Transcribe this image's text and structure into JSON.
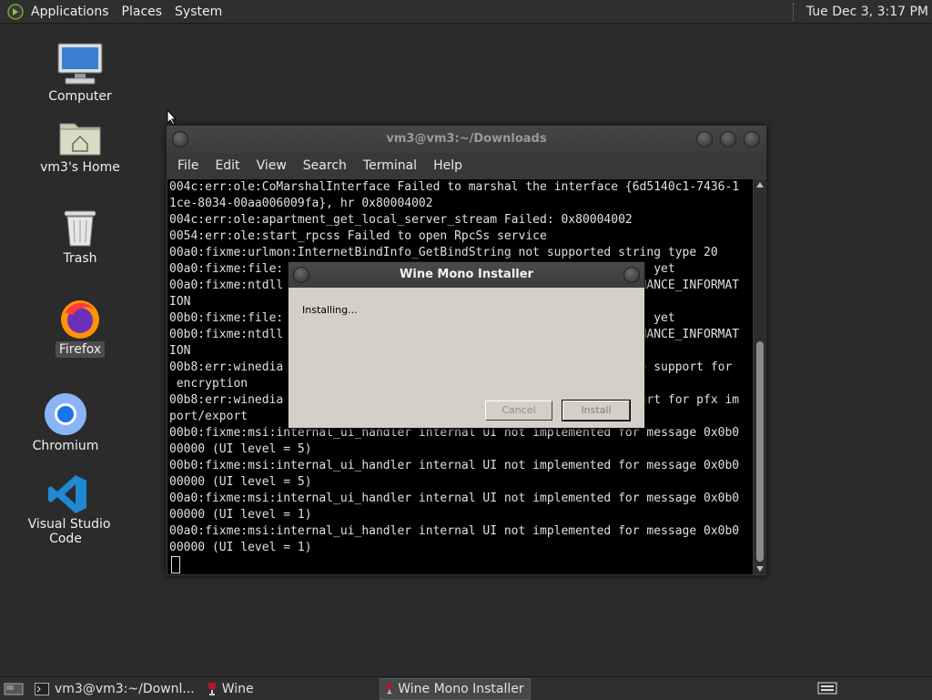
{
  "top_panel": {
    "menus": [
      "Applications",
      "Places",
      "System"
    ],
    "clock": "Tue Dec  3,  3:17 PM"
  },
  "desktop": {
    "icons": [
      {
        "label": "Computer",
        "icon": "computer-icon"
      },
      {
        "label": "vm3's Home",
        "icon": "home-folder-icon"
      },
      {
        "label": "Trash",
        "icon": "trash-icon"
      },
      {
        "label": "Firefox",
        "icon": "firefox-icon"
      },
      {
        "label": "Chromium",
        "icon": "chromium-icon"
      },
      {
        "label": "Visual Studio Code",
        "icon": "vscode-icon"
      }
    ]
  },
  "terminal": {
    "title": "vm3@vm3:~/Downloads",
    "menu": [
      "File",
      "Edit",
      "View",
      "Search",
      "Terminal",
      "Help"
    ],
    "lines": [
      "004c:err:ole:CoMarshalInterface Failed to marshal the interface {6d5140c1-7436-1",
      "1ce-8034-00aa006009fa}, hr 0x80004002",
      "004c:err:ole:apartment_get_local_server_stream Failed: 0x80004002",
      "0054:err:ole:start_rpcss Failed to open RpcSs service",
      "00a0:fixme:urlmon:InternetBindInfo_GetBindString not supported string type 20",
      "00a0:fixme:file:                                                    yet",
      "00a0:fixme:ntdll                                                 RMANCE_INFORMAT",
      "ION",
      "00b0:fixme:file:                                                    yet",
      "00b0:fixme:ntdll                                                 RMANCE_INFORMAT",
      "ION",
      "00b8:err:winedia                                                 no support for",
      " encryption",
      "00b8:err:winedia                                                 port for pfx im",
      "port/export",
      "00b0:fixme:msi:internal_ui_handler internal UI not implemented for message 0x0b0",
      "00000 (UI level = 5)",
      "00b0:fixme:msi:internal_ui_handler internal UI not implemented for message 0x0b0",
      "00000 (UI level = 5)",
      "00a0:fixme:msi:internal_ui_handler internal UI not implemented for message 0x0b0",
      "00000 (UI level = 1)",
      "00a0:fixme:msi:internal_ui_handler internal UI not implemented for message 0x0b0",
      "00000 (UI level = 1)"
    ]
  },
  "wine_dialog": {
    "title": "Wine Mono Installer",
    "status": "Installing...",
    "cancel_label": "Cancel",
    "install_label": "Install"
  },
  "taskbar": {
    "tasks": [
      {
        "label": "vm3@vm3:~/Downl...",
        "icon": "terminal-icon",
        "active": false
      },
      {
        "label": "Wine",
        "icon": "wine-icon",
        "active": false
      },
      {
        "label": "Wine Mono Installer",
        "icon": "wine-icon",
        "active": true
      }
    ]
  }
}
